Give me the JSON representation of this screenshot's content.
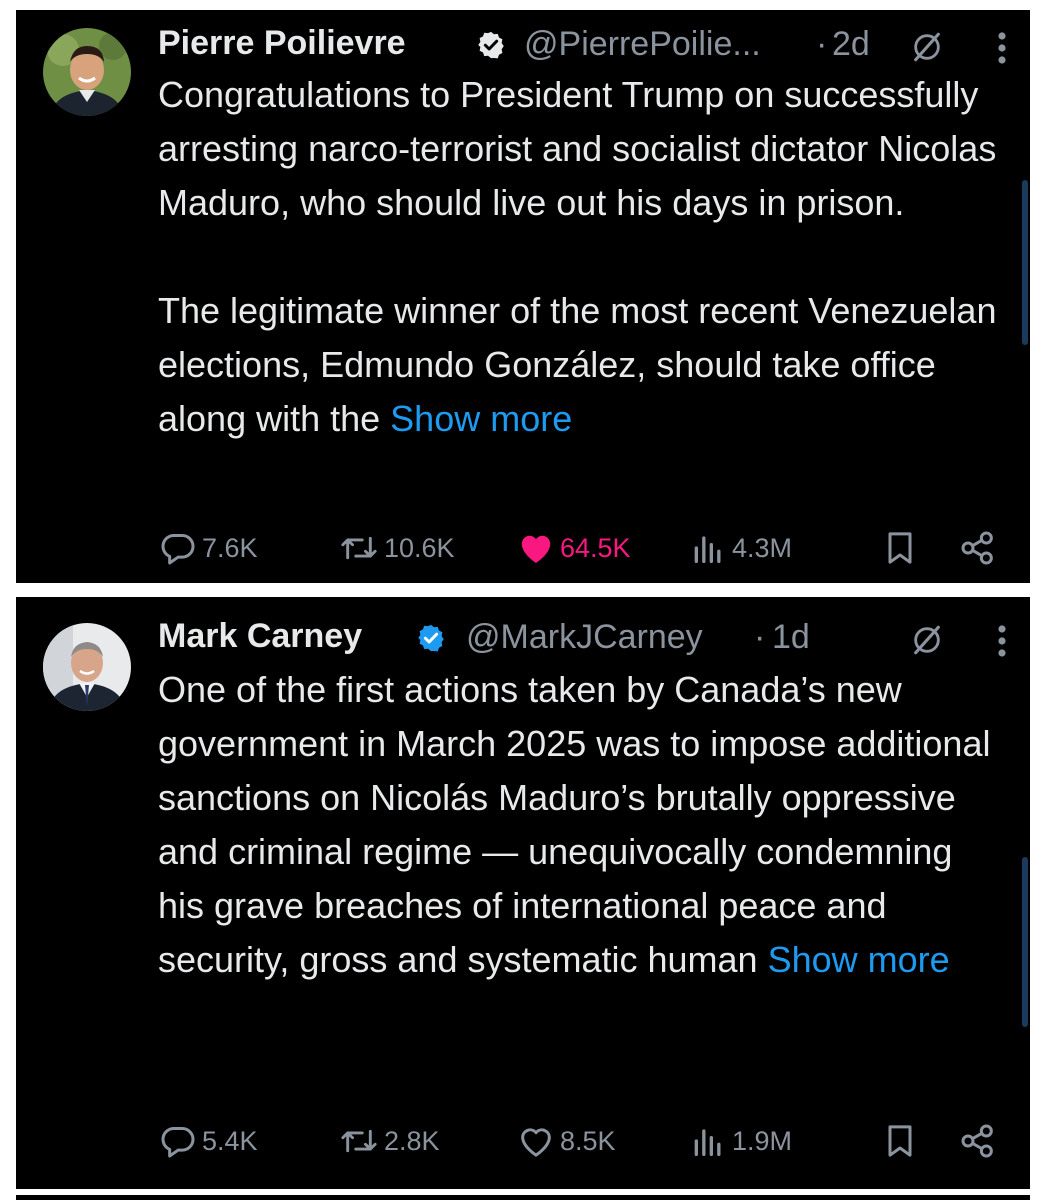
{
  "tweets": [
    {
      "name": "Pierre Poilievre",
      "handle": "@PierrePoilie...",
      "separator": "·",
      "time": "2d",
      "body": [
        "Congratulations to President Trump on successfully arresting narco-terrorist and socialist dictator Nicolas Maduro, who should live out his days in prison.",
        "The legitimate winner of the most recent Venezuelan elections, Edmundo González, should take office along with the"
      ],
      "show_more": "Show more",
      "replies": "7.6K",
      "reposts": "10.6K",
      "likes": "64.5K",
      "liked": true,
      "views": "4.3M"
    },
    {
      "name": "Mark Carney",
      "handle": "@MarkJCarney",
      "separator": "·",
      "time": "1d",
      "body": [
        "One of the first actions taken by Canada’s new government in March 2025 was to impose additional sanctions on Nicolás Maduro’s brutally oppressive and criminal regime — unequivocally condemning his grave breaches of international peace and security, gross and systematic human"
      ],
      "show_more": "Show more",
      "replies": "5.4K",
      "reposts": "2.8K",
      "likes": "8.5K",
      "liked": false,
      "views": "1.9M"
    }
  ],
  "colors": {
    "background": "#000000",
    "text": "#e7e9ea",
    "muted": "#8b949e",
    "link": "#1d9bf0",
    "like": "#f91880",
    "verified": "#1d9bf0"
  }
}
